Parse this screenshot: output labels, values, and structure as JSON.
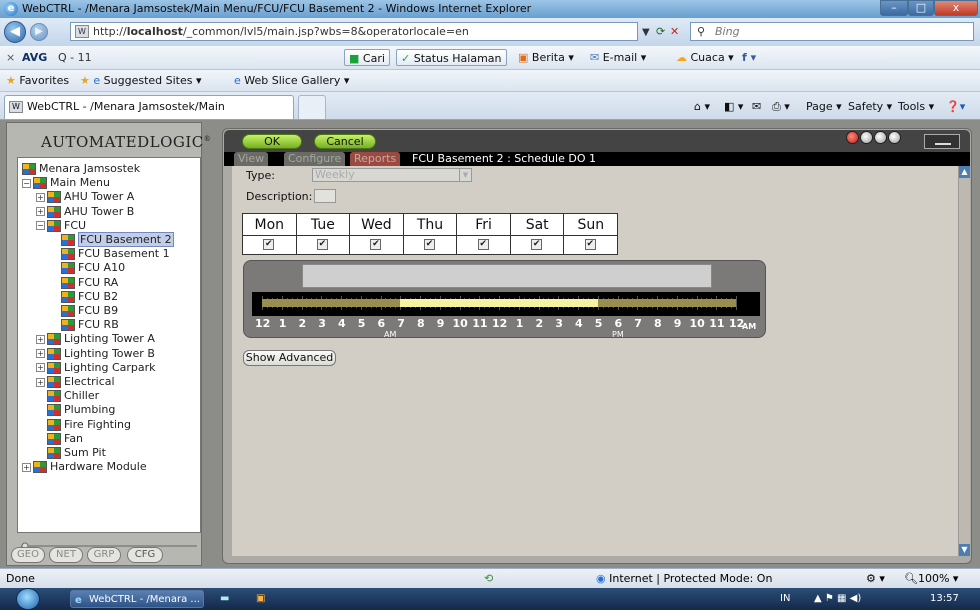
{
  "browser": {
    "window_title": "WebCTRL - /Menara Jamsostek/Main Menu/FCU/FCU Basement 2 - Windows Internet Explorer",
    "url_prefix": "http://",
    "url_host": "localhost",
    "url_path": "/_common/lvl5/main.jsp?wbs=8&operatorlocale=en",
    "search_placeholder": "Bing",
    "tab_title": "WebCTRL - /Menara Jamsostek/Main Menu/FCU...",
    "minimize": "–",
    "maximize": "□",
    "close": "x"
  },
  "toolbar": {
    "close_x": "×",
    "avg": "AVG",
    "avg_search": "Q - 11",
    "cari": "Cari",
    "status_halaman": "Status Halaman",
    "berita": "Berita",
    "email": "E-mail",
    "cuaca": "Cuaca"
  },
  "favbar": {
    "favorites": "Favorites",
    "suggested": "Suggested Sites",
    "slice": "Web Slice Gallery",
    "page": "Page",
    "safety": "Safety",
    "tools": "Tools"
  },
  "left": {
    "logo": "AUTOMATEDLOGIC",
    "logo_mark": "®",
    "tree": [
      {
        "label": "Menara Jamsostek",
        "level": 0,
        "exp": ""
      },
      {
        "label": "Main Menu",
        "level": 0,
        "exp": "−"
      },
      {
        "label": "AHU Tower A",
        "level": 1,
        "exp": "+"
      },
      {
        "label": "AHU Tower B",
        "level": 1,
        "exp": "+"
      },
      {
        "label": "FCU",
        "level": 1,
        "exp": "−"
      },
      {
        "label": "FCU Basement 2",
        "level": 2,
        "exp": "",
        "selected": true
      },
      {
        "label": "FCU Basement 1",
        "level": 2,
        "exp": ""
      },
      {
        "label": "FCU A10",
        "level": 2,
        "exp": ""
      },
      {
        "label": "FCU RA",
        "level": 2,
        "exp": ""
      },
      {
        "label": "FCU B2",
        "level": 2,
        "exp": ""
      },
      {
        "label": "FCU B9",
        "level": 2,
        "exp": ""
      },
      {
        "label": "FCU RB",
        "level": 2,
        "exp": ""
      },
      {
        "label": "Lighting Tower A",
        "level": 1,
        "exp": "+"
      },
      {
        "label": "Lighting Tower B",
        "level": 1,
        "exp": "+"
      },
      {
        "label": "Lighting Carpark",
        "level": 1,
        "exp": "+"
      },
      {
        "label": "Electrical",
        "level": 1,
        "exp": "+"
      },
      {
        "label": "Chiller",
        "level": 1,
        "exp": ""
      },
      {
        "label": "Plumbing",
        "level": 1,
        "exp": ""
      },
      {
        "label": "Fire Fighting",
        "level": 1,
        "exp": ""
      },
      {
        "label": "Fan",
        "level": 1,
        "exp": ""
      },
      {
        "label": "Sum Pit",
        "level": 1,
        "exp": ""
      },
      {
        "label": "Hardware Module",
        "level": 0,
        "exp": "+"
      }
    ],
    "buttons": [
      "GEO",
      "NET",
      "GRP",
      "CFG"
    ]
  },
  "main": {
    "ok": "OK",
    "cancel": "Cancel",
    "tabs": [
      "View",
      "Configure",
      "Reports"
    ],
    "title": "FCU Basement 2 : Schedule DO 1",
    "type_label": "Type:",
    "type_value": "Weekly",
    "desc_label": "Description:",
    "days": [
      {
        "name": "Mon",
        "checked": true
      },
      {
        "name": "Tue",
        "checked": true
      },
      {
        "name": "Wed",
        "checked": true
      },
      {
        "name": "Thu",
        "checked": true
      },
      {
        "name": "Fri",
        "checked": true
      },
      {
        "name": "Sat",
        "checked": true
      },
      {
        "name": "Sun",
        "checked": true
      }
    ],
    "hours": [
      "12",
      "1",
      "2",
      "3",
      "4",
      "5",
      "6",
      "7",
      "8",
      "9",
      "10",
      "11",
      "12",
      "1",
      "2",
      "3",
      "4",
      "5",
      "6",
      "7",
      "8",
      "9",
      "10",
      "11",
      "12"
    ],
    "am_label": "AM",
    "pm_label": "PM",
    "end_am": "AM",
    "schedule_on_hours": [
      7,
      17
    ],
    "show_advanced": "Show Advanced"
  },
  "status": {
    "left": "Done",
    "zone": "Internet | Protected Mode: On",
    "zoom": "100%"
  },
  "taskbar": {
    "item": "WebCTRL - /Menara ...",
    "lang": "IN",
    "time": "13:57"
  },
  "colors": {
    "schedule_on": "#f5f2a0",
    "schedule_off": "#9a8e4e",
    "ok_green": "#9fd840"
  }
}
